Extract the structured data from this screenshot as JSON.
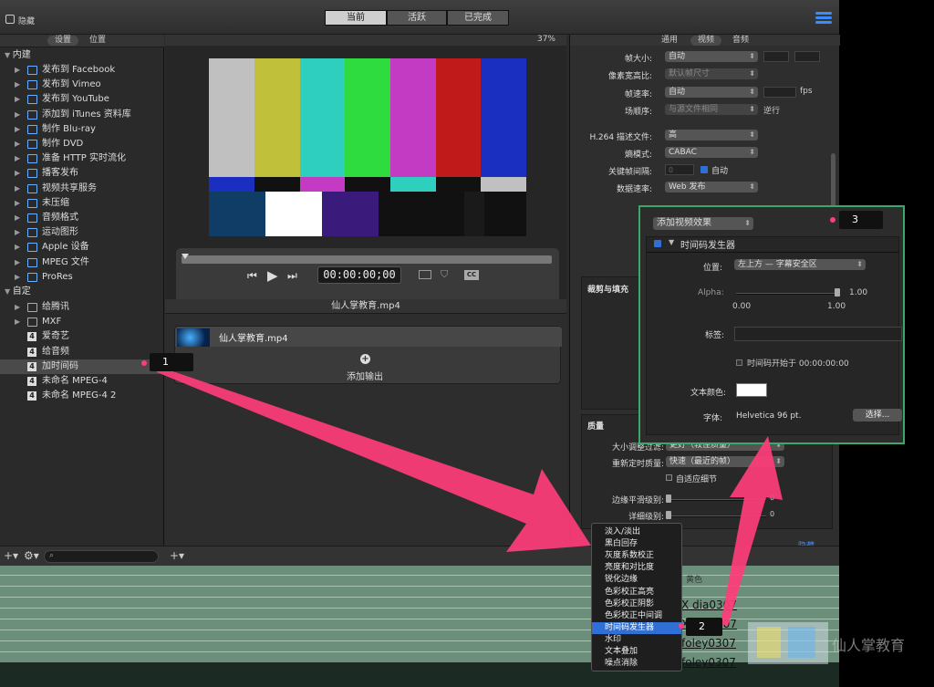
{
  "titlebar": {
    "hide_label": "隐藏",
    "segments": [
      "当前",
      "活跃",
      "已完成"
    ]
  },
  "left": {
    "tabs": [
      "设置",
      "位置"
    ],
    "group_builtin": "内建",
    "builtin_items": [
      "发布到 Facebook",
      "发布到 Vimeo",
      "发布到 YouTube",
      "添加到 iTunes 资料库",
      "制作 Blu-ray",
      "制作 DVD",
      "准备 HTTP 实时流化",
      "播客发布",
      "视频共享服务",
      "未压缩",
      "音频格式",
      "运动图形",
      "Apple 设备",
      "MPEG 文件",
      "ProRes"
    ],
    "group_custom": "自定",
    "custom_items": [
      "给腾讯",
      "MXF",
      "爱奇艺",
      "给音频",
      "加时间码",
      "未命名 MPEG-4",
      "未命名 MPEG-4 2"
    ],
    "selected_item": "加时间码"
  },
  "preview": {
    "zoom": "37%",
    "timecode": "00:00:00;00",
    "filename": "仙人掌教育.mp4",
    "cc": "CC"
  },
  "job": {
    "filename": "仙人掌教育.mp4",
    "add_output": "添加输出"
  },
  "right": {
    "tabs": [
      "通用",
      "视频",
      "音频"
    ],
    "rows": [
      {
        "label": "帧大小:",
        "value": "自动"
      },
      {
        "label": "像素宽高比:",
        "value": "默认帧尺寸"
      },
      {
        "label": "帧速率:",
        "value": "自动",
        "unit": "fps"
      },
      {
        "label": "场顺序:",
        "value": "与源文件相同",
        "extra": "逆行"
      },
      {
        "label": "H.264 描述文件:",
        "value": "高"
      },
      {
        "label": "熵模式:",
        "value": "CABAC"
      },
      {
        "label": "关键帧间隔:",
        "value": "0",
        "check": "自动"
      },
      {
        "label": "数据速率:",
        "value": "Web 发布"
      }
    ],
    "crop_section": "裁剪与填充",
    "quality_section": "质量",
    "quality_rows": [
      {
        "label": "大小调整过滤:",
        "value": "更好（较佳质量）"
      },
      {
        "label": "重新定时质量:",
        "value": "快速（最近的帧）"
      }
    ],
    "adaptive": "自适应细节",
    "antialias": "边缘平滑级别:",
    "detail": "详细级别:",
    "slider_zero": "0",
    "hide_button": "隐藏"
  },
  "popup": {
    "add_effect": "添加视频效果",
    "effect_name": "时间码发生器",
    "position_label": "位置:",
    "position_value": "左上方 — 字幕安全区",
    "alpha_label": "Alpha:",
    "alpha_value": "1.00",
    "tick_min": "0.00",
    "tick_max": "1.00",
    "tag_label": "标签:",
    "start_label": "时间码开始于 00:00:00:00",
    "color_label": "文本颜色:",
    "font_label": "字体:",
    "font_value": "Helvetica 96 pt.",
    "choose": "选择..."
  },
  "menu": {
    "items": [
      "淡入/淡出",
      "黑白回存",
      "灰度系数校正",
      "亮度和对比度",
      "锐化边缘",
      "色彩校正高亮",
      "色彩校正阴影",
      "色彩校正中间调",
      "时间码发生器",
      "水印",
      "文本叠加",
      "噪点消除"
    ],
    "selected": "时间码发生器"
  },
  "timeline": {
    "clips": [
      "X dia0307",
      "X dia0307",
      "foley0307",
      "foley0307"
    ],
    "watermark": "仙人掌教育",
    "partial": "黄色"
  },
  "badges": [
    "1",
    "2",
    "3"
  ],
  "colors": {
    "accent": "#ff3d7a",
    "popup_border": "#3aa86a",
    "selection": "#2f6fd6"
  }
}
